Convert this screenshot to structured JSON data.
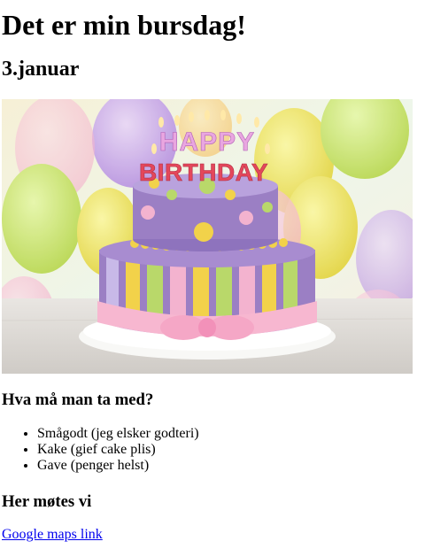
{
  "page": {
    "title": "Det er min bursdag!",
    "date": "3.januar"
  },
  "hero_image": {
    "topper_line1": "HAPPY",
    "topper_line2": "BIRTHDAY"
  },
  "bring": {
    "heading": "Hva må man ta med?",
    "items": [
      "Smågodt (jeg elsker godteri)",
      "Kake (gief cake plis)",
      "Gave (penger helst)"
    ]
  },
  "meet": {
    "heading": "Her møtes vi",
    "link_label": "Google maps link"
  },
  "colors": {
    "link": "#0000ee",
    "cake_purple": "#9b7fc4",
    "cake_pink": "#f3b3cf",
    "cake_yellow": "#f2d24a",
    "cake_green": "#b9d86a"
  }
}
